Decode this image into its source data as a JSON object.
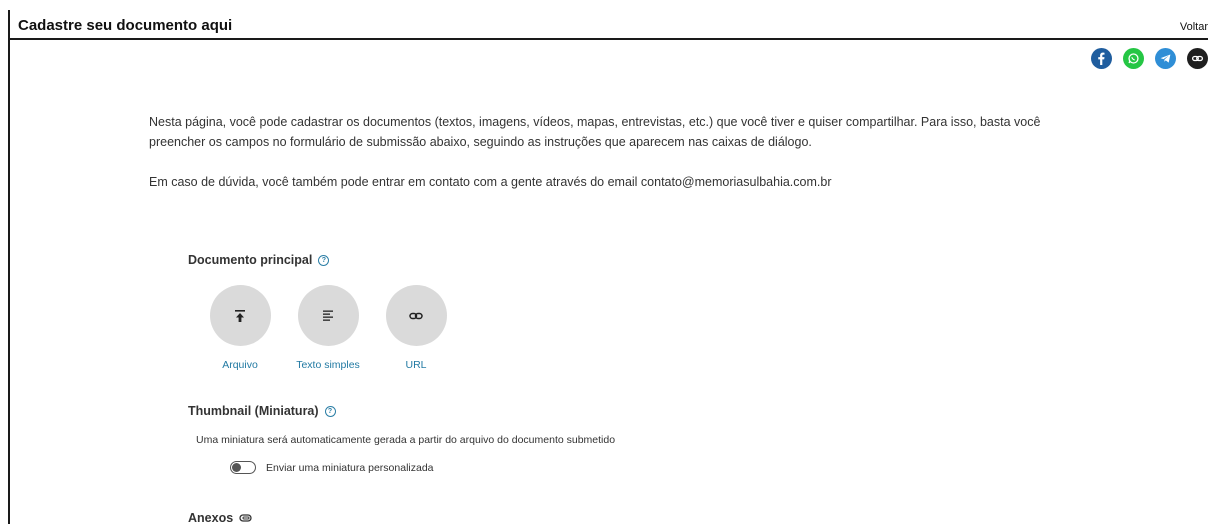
{
  "header": {
    "title": "Cadastre seu documento aqui",
    "back_label": "Voltar"
  },
  "share": [
    {
      "name": "facebook-icon",
      "color": "#1f5d9e"
    },
    {
      "name": "whatsapp-icon",
      "color": "#25c644"
    },
    {
      "name": "telegram-icon",
      "color": "#2f8ed6"
    },
    {
      "name": "link-icon",
      "color": "#1f1f1f"
    }
  ],
  "intro": {
    "paragraph1": "Nesta página, você pode cadastrar os documentos (textos, imagens, vídeos, mapas, entrevistas, etc.) que você tiver e quiser compartilhar. Para isso, basta você preencher os campos no formulário de submissão abaixo, seguindo as instruções que aparecem nas caixas de diálogo.",
    "paragraph2": "Em caso de dúvida, você também pode entrar em contato com a gente através do email contato@memoriasulbahia.com.br"
  },
  "main_document": {
    "label": "Documento principal",
    "help_icon": "?",
    "options": [
      {
        "label": "Arquivo",
        "icon": "upload-icon"
      },
      {
        "label": "Texto simples",
        "icon": "text-icon"
      },
      {
        "label": "URL",
        "icon": "link-icon"
      }
    ]
  },
  "thumbnail": {
    "label": "Thumbnail (Miniatura)",
    "help_icon": "?",
    "note": "Uma miniatura será automaticamente gerada a partir do arquivo do documento submetido",
    "toggle_label": "Enviar uma miniatura personalizada",
    "toggle_on": false
  },
  "attachments": {
    "label": "Anexos"
  },
  "colors": {
    "accent": "#227aa3",
    "option_bg": "#dadada"
  }
}
